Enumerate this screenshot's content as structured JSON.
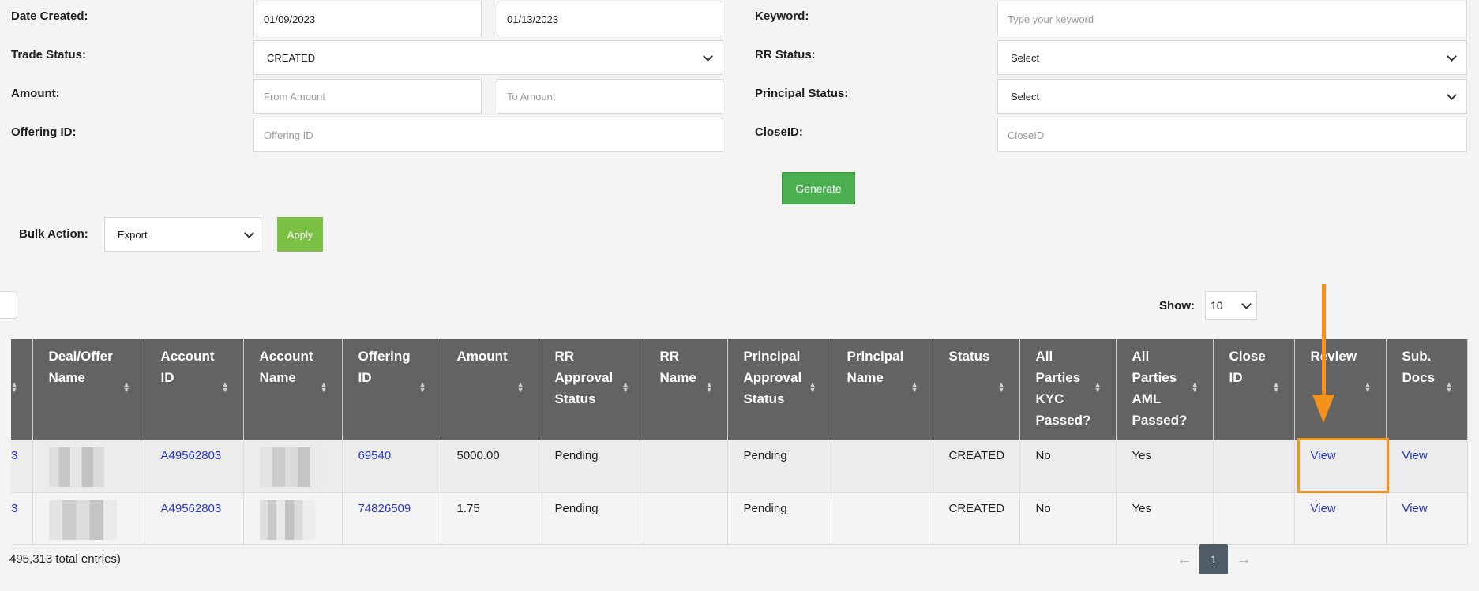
{
  "filters": {
    "date_created_label": "Date Created:",
    "date_from": "01/09/2023",
    "date_to": "01/13/2023",
    "keyword_label": "Keyword:",
    "keyword_placeholder": "Type your keyword",
    "trade_status_label": "Trade Status:",
    "trade_status_value": "CREATED",
    "rr_status_label": "RR Status:",
    "rr_status_value": "Select",
    "amount_label": "Amount:",
    "amount_from_placeholder": "From Amount",
    "amount_to_placeholder": "To Amount",
    "principal_status_label": "Principal Status:",
    "principal_status_value": "Select",
    "offering_id_label": "Offering ID:",
    "offering_id_placeholder": "Offering ID",
    "close_id_label": "CloseID:",
    "close_id_placeholder": "CloseID",
    "generate_label": "Generate"
  },
  "bulk": {
    "label": "Bulk Action:",
    "value": "Export",
    "apply_label": "Apply"
  },
  "show": {
    "label": "Show:",
    "value": "10"
  },
  "table": {
    "headers": [
      "",
      "Deal/Offer Name",
      "Account ID",
      "Account Name",
      "Offering ID",
      "Amount",
      "RR Approval Status",
      "RR Name",
      "Principal Approval Status",
      "Principal Name",
      "Status",
      "All Parties KYC Passed?",
      "All Parties AML Passed?",
      "Close ID",
      "Review",
      "Sub. Docs"
    ],
    "rows": [
      {
        "first": "3",
        "account_id": "A49562803",
        "offering_id": "69540",
        "amount": "5000.00",
        "rr_status": "Pending",
        "rr_name": "",
        "principal_status": "Pending",
        "principal_name": "",
        "status": "CREATED",
        "kyc": "No",
        "aml": "Yes",
        "close_id": "",
        "review": "View",
        "sub_docs": "View"
      },
      {
        "first": "3",
        "account_id": "A49562803",
        "offering_id": "74826509",
        "amount": "1.75",
        "rr_status": "Pending",
        "rr_name": "",
        "principal_status": "Pending",
        "principal_name": "",
        "status": "CREATED",
        "kyc": "No",
        "aml": "Yes",
        "close_id": "",
        "review": "View",
        "sub_docs": "View"
      }
    ]
  },
  "footer": {
    "entries_text": "495,313 total entries)",
    "prev": "←",
    "page": "1",
    "next": "→"
  },
  "colors": {
    "header_bg": "#636363",
    "link": "#2a39cc",
    "generate_bg": "#4caf50",
    "apply_bg": "#7bc043",
    "annotation": "#f5921e"
  }
}
